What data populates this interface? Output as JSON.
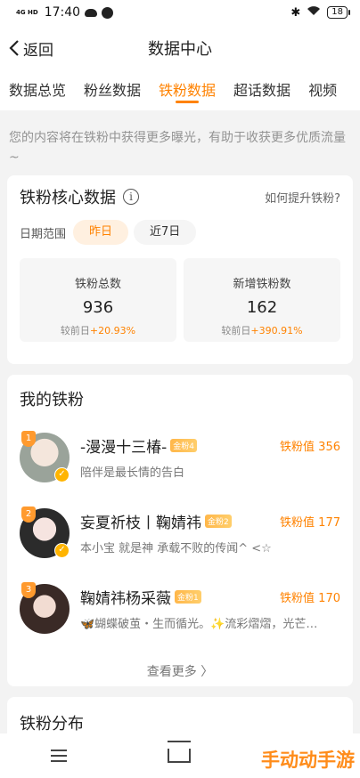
{
  "status": {
    "network": "4G HD",
    "time": "17:40",
    "battery": "18"
  },
  "nav": {
    "back_label": "返回",
    "title": "数据中心"
  },
  "tabs": [
    {
      "label": "数据总览"
    },
    {
      "label": "粉丝数据"
    },
    {
      "label": "铁粉数据",
      "active": true
    },
    {
      "label": "超话数据"
    },
    {
      "label": "视频"
    }
  ],
  "tip": "您的内容将在铁粉中获得更多曝光，有助于收获更多优质流量~",
  "core": {
    "title": "铁粉核心数据",
    "info_icon": "i",
    "help_link": "如何提升铁粉?",
    "date_label": "日期范围",
    "date_options": [
      "昨日",
      "近7日"
    ],
    "date_selected": "昨日",
    "stats": [
      {
        "label": "铁粉总数",
        "value": "936",
        "compare_label": "较前日",
        "compare_value": "+20.93%"
      },
      {
        "label": "新增铁粉数",
        "value": "162",
        "compare_label": "较前日",
        "compare_value": "+390.91%"
      }
    ]
  },
  "fans": {
    "title": "我的铁粉",
    "items": [
      {
        "rank": "1",
        "name": "-漫漫十三椿-",
        "level": "金粉4",
        "score": "铁粉值 356",
        "bio": "陪伴是最长情的告白"
      },
      {
        "rank": "2",
        "name": "妄夏祈枝丨鞠婧祎",
        "level": "金粉2",
        "score": "铁粉值 177",
        "bio": "本小宝 就是神 承载不败的传闻^ <☆"
      },
      {
        "rank": "3",
        "name": "鞠婧祎杨采薇",
        "level": "金粉1",
        "score": "铁粉值 170",
        "bio": "🦋蝴蝶破茧・生而循光。✨流彩熠熠，光芒…"
      }
    ],
    "more_label": "查看更多 〉"
  },
  "distribution": {
    "title": "铁粉分布"
  },
  "watermark": "手动动手游",
  "colors": {
    "accent": "#ff8200",
    "background": "#f3f3f3"
  }
}
